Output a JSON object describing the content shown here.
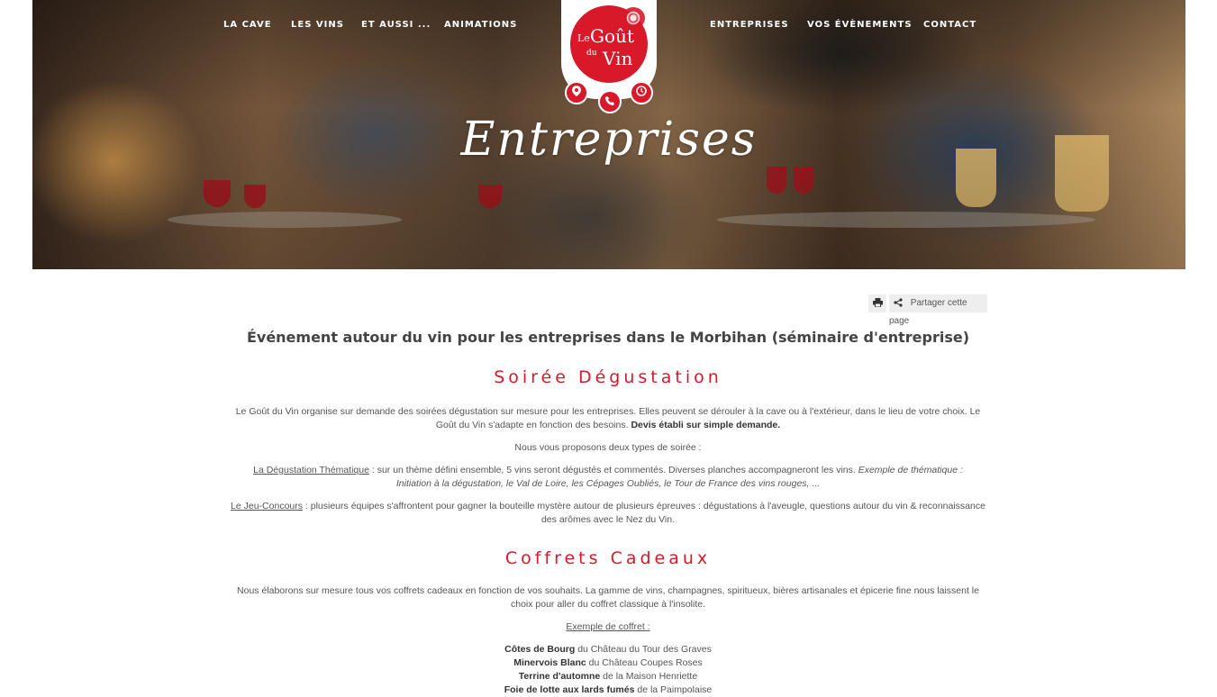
{
  "nav": {
    "left": [
      "LA CAVE",
      "LES VINS",
      "ET AUSSI ...",
      "ANIMATIONS"
    ],
    "right": [
      "ENTREPRISES",
      "VOS ÉVÈNEMENTS",
      "CONTACT"
    ]
  },
  "logo": {
    "line1": "Le",
    "line2": "Goût",
    "line3": "du",
    "line4": "Vin"
  },
  "hero": {
    "title": "Entreprises"
  },
  "quick_icons": [
    "location-icon",
    "phone-icon",
    "clock-icon"
  ],
  "share": {
    "print_icon": "print-icon",
    "share_icon": "share-icon",
    "label": "Partager cette page"
  },
  "page": {
    "subtitle": "Événement autour du vin pour les entreprises dans le Morbihan (séminaire d'entreprise)",
    "s1": {
      "title": "Soirée Dégustation",
      "p1": "Le Goût du Vin organise sur demande des soirées dégustation sur mesure pour les entreprises. Elles peuvent se dérouler à la cave ou à l'extérieur, dans le lieu de votre choix. Le Goût du Vin s'adapte en fonction des besoins.",
      "p1_bold": "Devis établi sur simple demande.",
      "p2": "Nous vous proposons deux types de soirée :",
      "p3_link": "La Dégustation Thématique",
      "p3": " : sur un thème défini ensemble, 5 vins seront dégustés et commentés. Diverses planches accompagneront les vins. ",
      "p3_italic": "Exemple de thématique : Initiation à la dégustation, le Val de Loire, les Cépages Oubliés, le Tour de France des vins rouges, ...",
      "p4_link": "Le Jeu-Concours",
      "p4": " : plusieurs équipes s'affrontent pour gagner la bouteille mystère autour de plusieurs épreuves : dégustations à l'aveugle, questions autour du vin & reconnaissance des arômes avec le Nez du Vin."
    },
    "s2": {
      "title": "Coffrets Cadeaux",
      "p1": "Nous élaborons sur mesure tous vos coffrets cadeaux en fonction de vos souhaits. La gamme de vins, champagnes, spiritueux, bières artisanales et épicerie fine nous laissent le choix pour aller du coffret classique à l'insolite.",
      "example_label": "Exemple de coffret :",
      "items": [
        {
          "bold": "Côtes de Bourg",
          "rest": " du Château du Tour des Graves"
        },
        {
          "bold": "Minervois Blanc",
          "rest": " du Château Coupes Roses"
        },
        {
          "bold": "Terrine d'automne",
          "rest": " de la Maison Henriette"
        },
        {
          "bold": "Foie de lotte aux lards fumés",
          "rest": " de la Paimpolaise"
        }
      ]
    }
  },
  "colors": {
    "accent": "#d7192a",
    "text": "#555555"
  }
}
